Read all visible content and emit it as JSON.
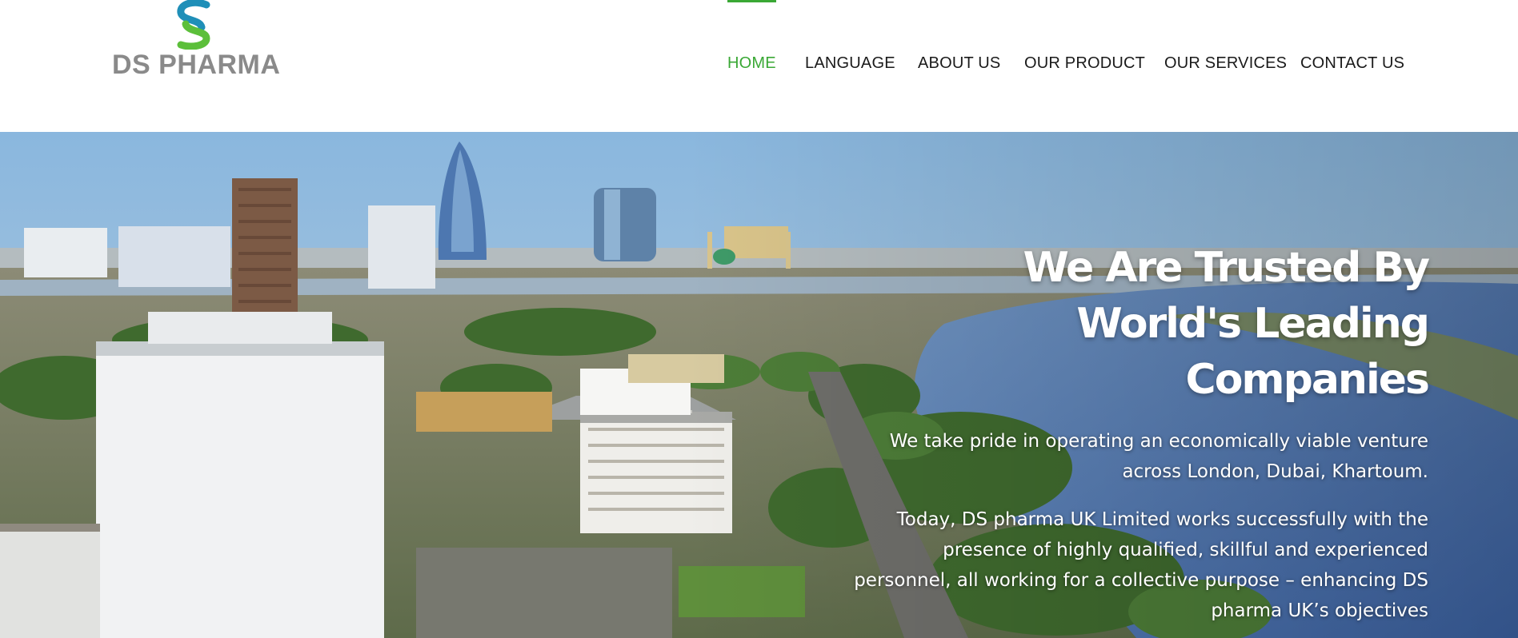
{
  "brand": {
    "name": "DS PHARMA",
    "colors": {
      "mark_teal": "#1f8fb8",
      "mark_green": "#5cbf3a",
      "text_gray": "#8a8a8a"
    }
  },
  "nav": {
    "active_color": "#3aa835",
    "items": [
      {
        "label": "HOME",
        "active": true
      },
      {
        "label": "LANGUAGE",
        "active": false
      },
      {
        "label": "ABOUT US",
        "active": false
      },
      {
        "label": "OUR PRODUCT",
        "active": false
      },
      {
        "label": "OUR SERVICES",
        "active": false
      },
      {
        "label": "CONTACT US",
        "active": false
      }
    ]
  },
  "hero": {
    "heading_line1": "We Are Trusted By",
    "heading_line2": "World's Leading",
    "heading_line3": "Companies",
    "paragraph1": "We take pride in operating an economically viable venture across London, Dubai, Khartoum.",
    "paragraph2": "Today, DS pharma UK Limited works successfully with the presence of highly qualified, skillful and experienced personnel, all working for a collective purpose – enhancing DS pharma UK’s objectives"
  }
}
